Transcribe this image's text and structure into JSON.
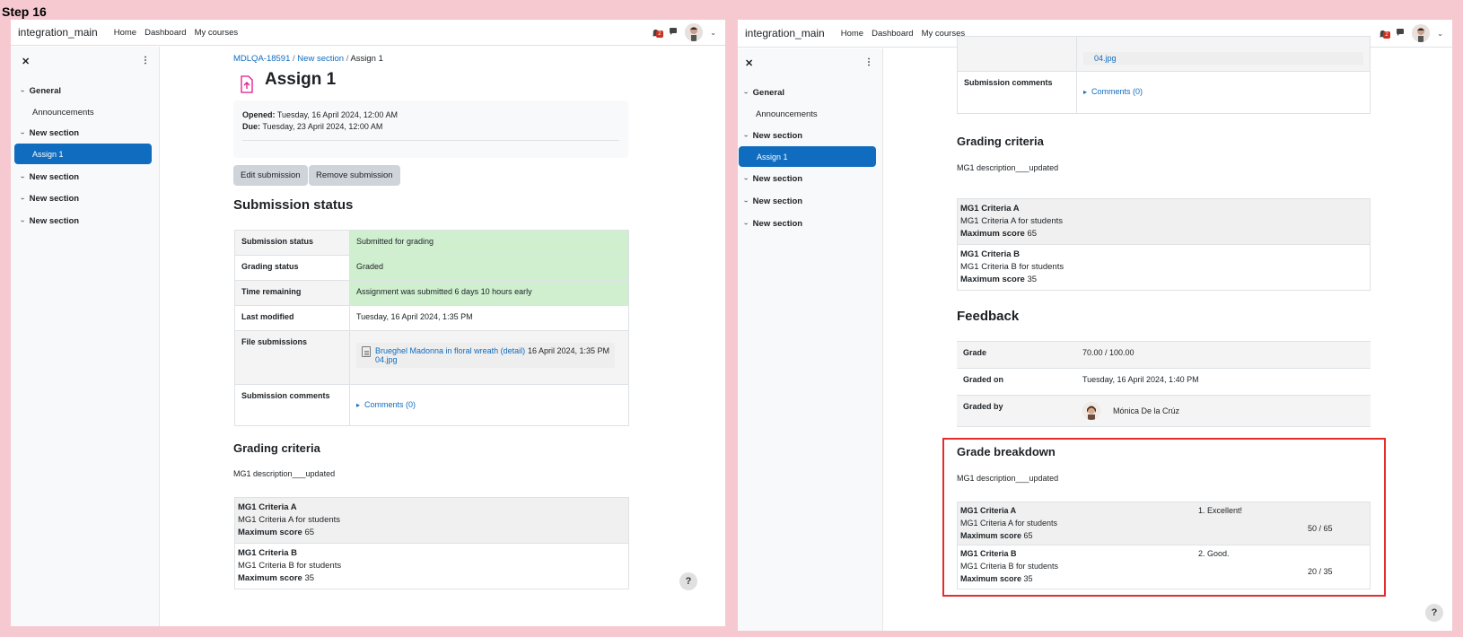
{
  "step_label": "Step 16",
  "navbar": {
    "brand": "integration_main",
    "links": [
      "Home",
      "Dashboard",
      "My courses"
    ],
    "notification_count": "2"
  },
  "drawer": {
    "items": [
      {
        "label": "General"
      },
      {
        "label": "Announcements"
      },
      {
        "label": "New section"
      },
      {
        "label": "Assign 1"
      },
      {
        "label": "New section"
      },
      {
        "label": "New section"
      },
      {
        "label": "New section"
      }
    ]
  },
  "left": {
    "breadcrumb": [
      "MDLQA-18591",
      "New section",
      "Assign 1"
    ],
    "title": "Assign 1",
    "opened_label": "Opened:",
    "opened_value": "Tuesday, 16 April 2024, 12:00 AM",
    "due_label": "Due:",
    "due_value": "Tuesday, 23 April 2024, 12:00 AM",
    "edit_button": "Edit submission",
    "remove_button": "Remove submission",
    "submission_status_heading": "Submission status",
    "status_rows": [
      {
        "label": "Submission status",
        "value": "Submitted for grading"
      },
      {
        "label": "Grading status",
        "value": "Graded"
      },
      {
        "label": "Time remaining",
        "value": "Assignment was submitted 6 days 10 hours early"
      },
      {
        "label": "Last modified",
        "value": "Tuesday, 16 April 2024, 1:35 PM"
      },
      {
        "label": "File submissions",
        "file_name": "Brueghel Madonna in floral wreath (detail) 04.jpg",
        "file_date": "16 April 2024, 1:35 PM"
      },
      {
        "label": "Submission comments",
        "value": "Comments (0)"
      }
    ]
  },
  "grading_criteria": {
    "heading": "Grading criteria",
    "description": "MG1 description___updated",
    "criteria": [
      {
        "name": "MG1 Criteria A",
        "desc": "MG1 Criteria A for students",
        "max_label": "Maximum score",
        "max": "65"
      },
      {
        "name": "MG1 Criteria B",
        "desc": "MG1 Criteria B for students",
        "max_label": "Maximum score",
        "max": "35"
      }
    ]
  },
  "right": {
    "top_file_fragment": "04.jpg",
    "submission_comments_label": "Submission comments",
    "comments_link": "Comments (0)",
    "feedback_heading": "Feedback",
    "feedback_rows": [
      {
        "label": "Grade",
        "value": "70.00 / 100.00"
      },
      {
        "label": "Graded on",
        "value": "Tuesday, 16 April 2024, 1:40 PM"
      },
      {
        "label": "Graded by",
        "value": "Mónica De la Crúz"
      }
    ],
    "breakdown_heading": "Grade breakdown",
    "breakdown_description": "MG1 description___updated",
    "breakdown": [
      {
        "name": "MG1 Criteria A",
        "desc": "MG1 Criteria A for students",
        "max_label": "Maximum score",
        "max": "65",
        "level": "1. Excellent!",
        "score": "50 / 65"
      },
      {
        "name": "MG1 Criteria B",
        "desc": "MG1 Criteria B for students",
        "max_label": "Maximum score",
        "max": "35",
        "level": "2. Good.",
        "score": "20 / 35"
      }
    ]
  },
  "help_label": "?"
}
